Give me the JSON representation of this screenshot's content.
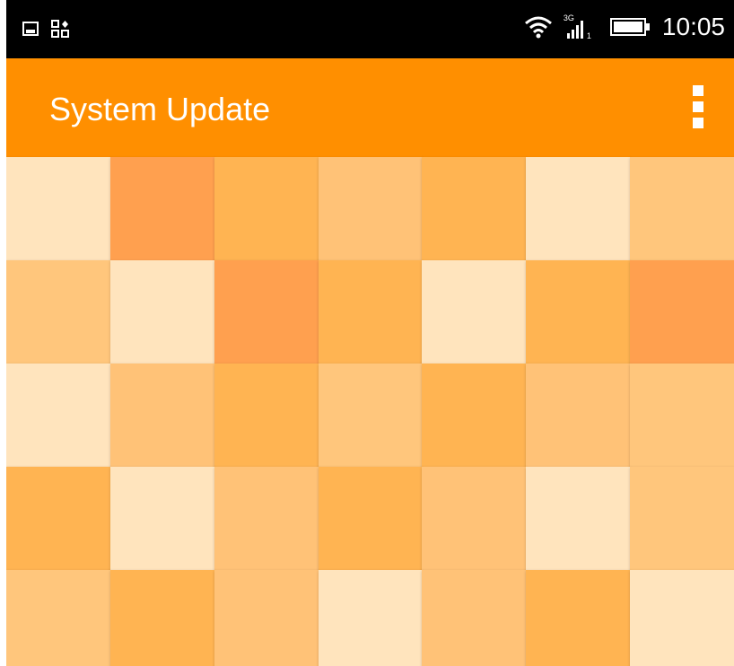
{
  "status_bar": {
    "time": "10:05",
    "icons": [
      "image-notification-icon",
      "app-switch-icon",
      "wifi-icon",
      "signal-3g-icon",
      "battery-icon"
    ],
    "network_label": "3G",
    "sim_slot": "1"
  },
  "app_bar": {
    "title": "System Update",
    "overflow_icon": "more-vert-icon"
  },
  "colors": {
    "app_bar": "#ff8f00",
    "status_bar": "#000000",
    "tiles": [
      "#ffe4bd",
      "#ffa04f",
      "#ffb452",
      "#ffc277",
      "#ffc67c"
    ]
  },
  "pattern": [
    [
      "#ffe4bd",
      "#ffa04f",
      "#ffb452",
      "#ffc277",
      "#ffb452",
      "#ffe4bd",
      "#ffc67c"
    ],
    [
      "#ffc67c",
      "#ffe4bd",
      "#ffa04f",
      "#ffb452",
      "#ffe4bd",
      "#ffb452",
      "#ffa04f"
    ],
    [
      "#ffe4bd",
      "#ffc277",
      "#ffb452",
      "#ffc67c",
      "#ffb452",
      "#ffc277",
      "#ffc67c"
    ],
    [
      "#ffb452",
      "#ffe4bd",
      "#ffc277",
      "#ffb452",
      "#ffc277",
      "#ffe4bd",
      "#ffc67c"
    ],
    [
      "#ffc67c",
      "#ffb452",
      "#ffc277",
      "#ffe4bd",
      "#ffc277",
      "#ffb452",
      "#ffe4bd"
    ]
  ]
}
